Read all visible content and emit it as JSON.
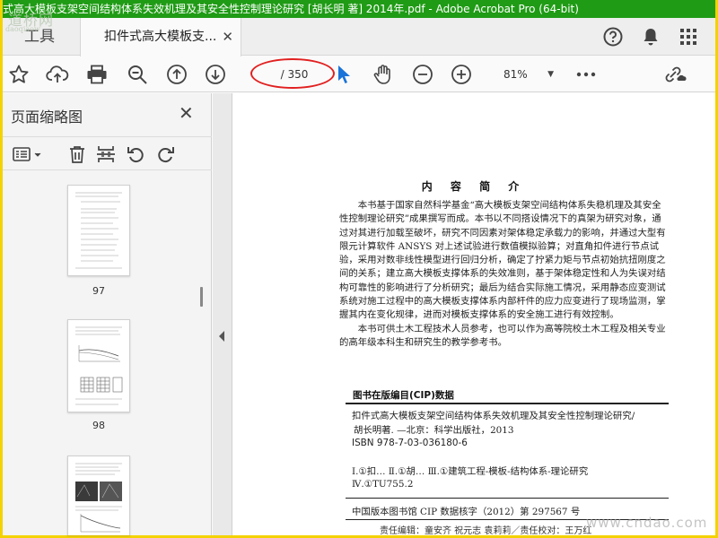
{
  "window": {
    "title": "式高大模板支架空间结构体系失效机理及其安全性控制理论研究 [胡长明 著] 2014年.pdf - Adobe Acrobat Pro (64-bit)"
  },
  "watermark_logo": {
    "top": "道桥网",
    "bottom": "daoqiaow"
  },
  "tabs": {
    "tools_label": "工具",
    "document_label": "扣件式高大模板支..."
  },
  "toolbar": {
    "page_indicator": "/ 350",
    "zoom_value": "81%",
    "highlight_color": "#e12020"
  },
  "sidebar": {
    "title": "页面缩略图",
    "thumbnails": [
      {
        "page_number": "97"
      },
      {
        "page_number": "98"
      }
    ]
  },
  "document": {
    "heading": "内 容 简 介",
    "paragraphs": [
      "本书基于国家自然科学基金“高大模板支架空间结构体系失稳机理及其安全性控制理论研究”成果撰写而成。本书以不同搭设情况下的真架为研究对象，通过对其进行加载至破坏，研究不同因素对架体稳定承载力的影响，并通过大型有限元计算软件 ANSYS 对上述试验进行数值模拟验算；对直角扣件进行节点试验，采用对数非线性模型进行回归分析，确定了拧紧力矩与节点初始抗扭刚度之间的关系；建立高大模板支撑体系的失效准则，基于架体稳定性和人为失误对结构可靠性的影响进行了分析研究；最后为结合实际施工情况，采用静态应变测试系统对施工过程中的高大模板支撑体系内部杆件的应力应变进行了现场监测，掌握其内在变化规律，进而对模板支撑体系的安全施工进行有效控制。",
      "本书可供土木工程技术人员参考，也可以作为高等院校土木工程及相关专业的高年级本科生和研究生的教学参考书。"
    ],
    "cip": {
      "title": "图书在版编目(CIP)数据",
      "lines": [
        "扣件式高大模板支架空间结构体系失效机理及其安全性控制理论研究/",
        "胡长明著. —北京：科学出版社，2013"
      ],
      "isbn": "ISBN 978-7-03-036180-6",
      "class_1": "Ⅰ.①扣…  Ⅱ.①胡…  Ⅲ.①建筑工程-模板-结构体系-理论研究",
      "class_2": "Ⅳ.①TU755.2",
      "cip_number": "中国版本图书馆 CIP 数据核字（2012）第 297567 号"
    },
    "editors": "责任编辑：童安齐  祝元志  袁莉莉／责任校对：王万红",
    "site_watermark": "www.cndao.com"
  }
}
